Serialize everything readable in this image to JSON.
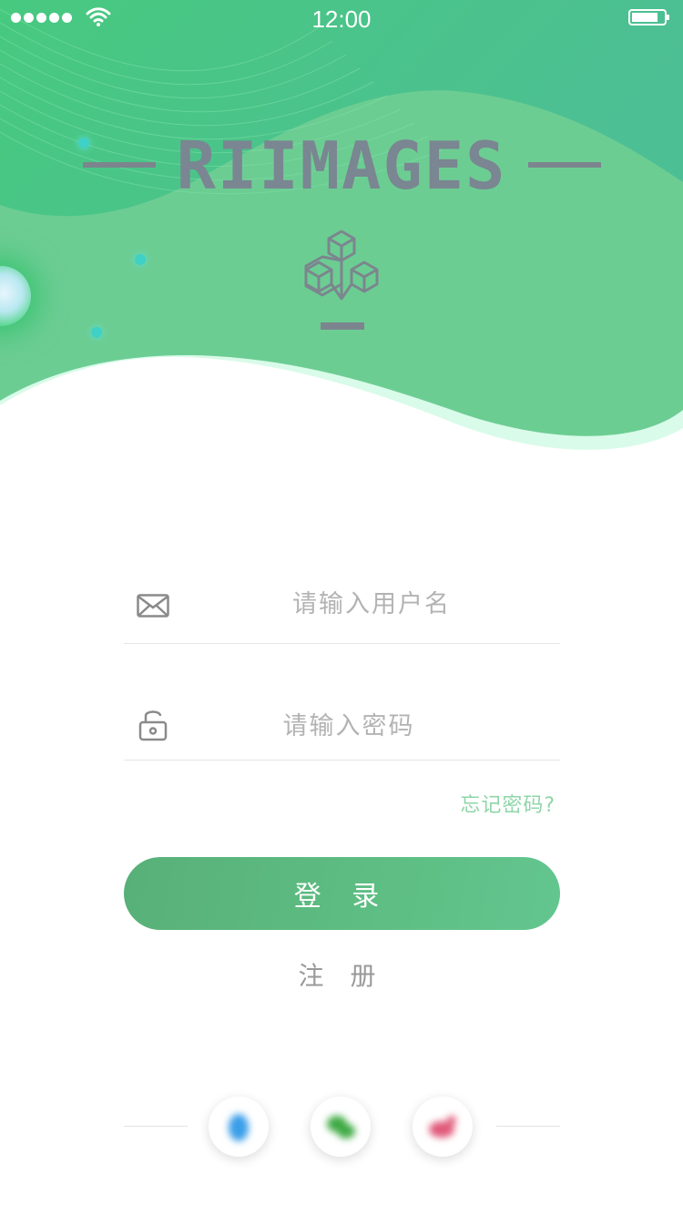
{
  "status_bar": {
    "time": "12:00"
  },
  "brand": {
    "title": "RIIMAGES"
  },
  "login_form": {
    "username_placeholder": "请输入用户名",
    "password_placeholder": "请输入密码",
    "forgot_label": "忘记密码?",
    "login_label": "登 录",
    "register_label": "注 册"
  },
  "social_login": {
    "items": [
      {
        "icon": "blue-social-icon",
        "color": "#3a9ee8"
      },
      {
        "icon": "green-social-icon",
        "color": "#3faa44"
      },
      {
        "icon": "red-social-icon",
        "color": "#e05a7a"
      }
    ]
  },
  "colors": {
    "brand_green": "#5cbd85",
    "header_green": "#6ccd93",
    "accent_link": "#8fd6a8"
  }
}
